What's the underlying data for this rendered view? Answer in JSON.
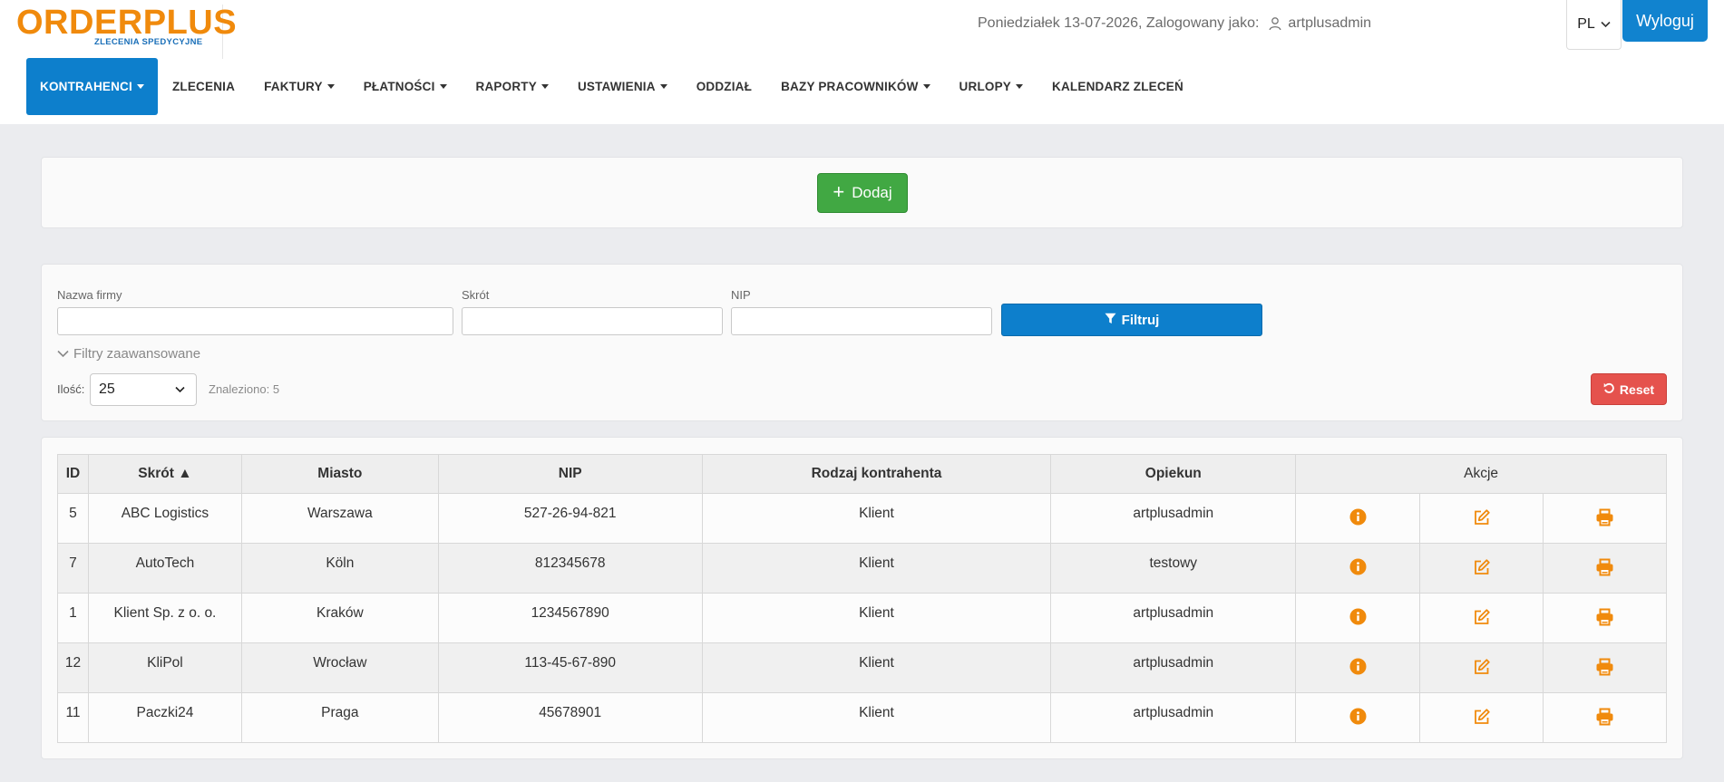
{
  "header": {
    "logo_main": "ORDERPLUS",
    "logo_sub": "ZLECENIA SPEDYCYJNE",
    "user_info": "Poniedziałek 13-07-2026, Zalogowany jako:",
    "username": "artplusadmin",
    "lang": "PL",
    "logout_label": "Wyloguj"
  },
  "nav": {
    "items": [
      {
        "label": "KONTRAHENCI",
        "dropdown": true,
        "active": true
      },
      {
        "label": "ZLECENIA",
        "dropdown": false
      },
      {
        "label": "FAKTURY",
        "dropdown": true
      },
      {
        "label": "PŁATNOŚCI",
        "dropdown": true
      },
      {
        "label": "RAPORTY",
        "dropdown": true
      },
      {
        "label": "USTAWIENIA",
        "dropdown": true
      },
      {
        "label": "ODDZIAŁ",
        "dropdown": false
      },
      {
        "label": "BAZY PRACOWNIKÓW",
        "dropdown": true
      },
      {
        "label": "URLOPY",
        "dropdown": true
      },
      {
        "label": "KALENDARZ ZLECEŃ",
        "dropdown": false
      }
    ]
  },
  "add": {
    "label": "Dodaj"
  },
  "filters": {
    "company_label": "Nazwa firmy",
    "company_value": "",
    "short_label": "Skrót",
    "short_value": "",
    "nip_label": "NIP",
    "nip_value": "",
    "filter_button": "Filtruj",
    "advanced": "Filtry zaawansowane",
    "qty_label": "Ilość:",
    "qty_value": "25",
    "found": "Znaleziono: 5",
    "reset_button": "Reset"
  },
  "table": {
    "headers": [
      "ID",
      "Skrót ▲",
      "Miasto",
      "NIP",
      "Rodzaj kontrahenta",
      "Opiekun",
      "Akcje"
    ],
    "rows": [
      [
        "5",
        "ABC Logistics",
        "Warszawa",
        "527-26-94-821",
        "Klient",
        "artplusadmin"
      ],
      [
        "7",
        "AutoTech",
        "Köln",
        "812345678",
        "Klient",
        "testowy"
      ],
      [
        "1",
        "Klient Sp. z o. o.",
        "Kraków",
        "1234567890",
        "Klient",
        "artplusadmin"
      ],
      [
        "12",
        "KliPol",
        "Wrocław",
        "113-45-67-890",
        "Klient",
        "artplusadmin"
      ],
      [
        "11",
        "Paczki24",
        "Praga",
        "45678901",
        "Klient",
        "artplusadmin"
      ]
    ],
    "action_icons": [
      "info-icon",
      "edit-icon",
      "print-icon"
    ]
  },
  "colors": {
    "brand_orange": "#f08a0c",
    "primary_blue": "#0d7fcc",
    "success_green": "#41a843",
    "danger_red": "#e5524d",
    "action_orange": "#f08a0c"
  }
}
